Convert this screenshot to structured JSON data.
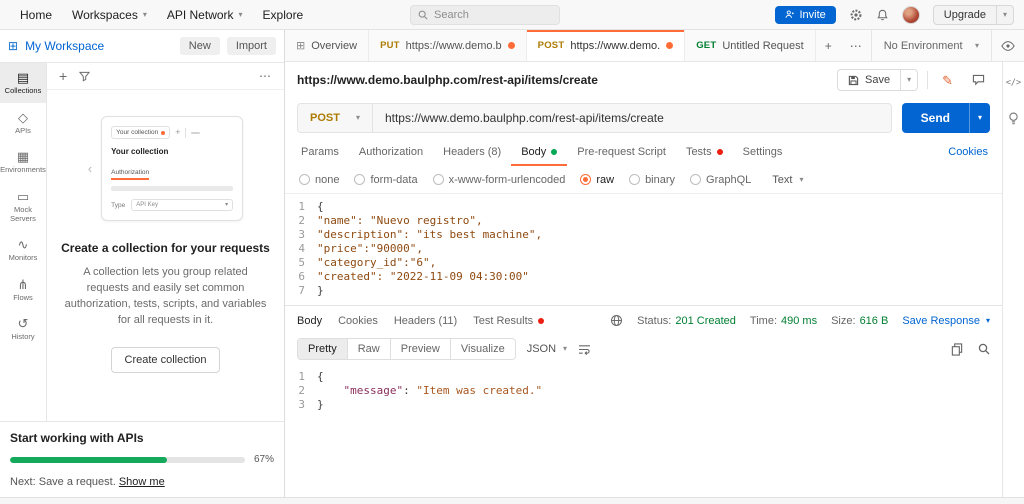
{
  "icons": {
    "caret": "▾",
    "grid": "⊞",
    "plus": "+",
    "ellipsis": "⋯",
    "code": "</>",
    "collapse": "‹",
    "pencil": "✎",
    "workspace": "⊞"
  },
  "topbar": {
    "nav": [
      "Home",
      "Workspaces",
      "API Network",
      "Explore"
    ],
    "search_placeholder": "Search",
    "invite_label": "Invite",
    "upgrade_label": "Upgrade"
  },
  "sidebar": {
    "workspace_title": "My Workspace",
    "new_button": "New",
    "import_button": "Import",
    "rail": [
      {
        "icon": "▤",
        "label": "Collections"
      },
      {
        "icon": "◇",
        "label": "APIs"
      },
      {
        "icon": "▦",
        "label": "Environments"
      },
      {
        "icon": "▭",
        "label": "Mock Servers"
      },
      {
        "icon": "∿",
        "label": "Monitors"
      },
      {
        "icon": "⋔",
        "label": "Flows"
      },
      {
        "icon": "↺",
        "label": "History"
      }
    ],
    "illustration": {
      "tab_label": "Your collection",
      "title": "Your collection",
      "auth_tab": "Authorization",
      "type_label": "Type",
      "type_value": "API Key"
    },
    "empty": {
      "title": "Create a collection for your requests",
      "description": "A collection lets you group related requests and easily set common authorization, tests, scripts, and variables for all requests in it.",
      "button": "Create collection"
    },
    "footer": {
      "title": "Start working with APIs",
      "percent": "67%",
      "progress_style": "width:67%",
      "next_prefix": "Next: Save a request.",
      "link": "Show me"
    }
  },
  "tabs": {
    "items": [
      {
        "label": "Overview"
      },
      {
        "method": "PUT",
        "label": "https://www.demo.b"
      },
      {
        "method": "POST",
        "label": "https://www.demo."
      },
      {
        "method": "GET",
        "label": "Untitled Request"
      }
    ],
    "environment": "No Environment"
  },
  "request": {
    "title": "https://www.demo.baulphp.com/rest-api/items/create",
    "save_label": "Save",
    "method": "POST",
    "url": "https://www.demo.baulphp.com/rest-api/items/create",
    "send_label": "Send",
    "tabs": [
      "Params",
      "Authorization",
      "Headers (8)",
      "Body",
      "Pre-request Script",
      "Tests",
      "Settings"
    ],
    "cookies_link": "Cookies",
    "body_types": [
      "none",
      "form-data",
      "x-www-form-urlencoded",
      "raw",
      "binary",
      "GraphQL"
    ],
    "language": "Text",
    "body_lines": [
      {
        "n": "1",
        "t": "{"
      },
      {
        "n": "2",
        "t": "\"name\": \"Nuevo registro\","
      },
      {
        "n": "3",
        "t": "\"description\": \"its best machine\","
      },
      {
        "n": "4",
        "t": "\"price\":\"90000\","
      },
      {
        "n": "5",
        "t": "\"category_id\":\"6\","
      },
      {
        "n": "6",
        "t": "\"created\": \"2022-11-09 04:30:00\""
      },
      {
        "n": "7",
        "t": "}"
      }
    ]
  },
  "response": {
    "tabs": [
      "Body",
      "Cookies",
      "Headers (11)",
      "Test Results"
    ],
    "meta": [
      {
        "label": "Status:",
        "value": "201 Created"
      },
      {
        "label": "Time:",
        "value": "490 ms"
      },
      {
        "label": "Size:",
        "value": "616 B"
      }
    ],
    "save_response": "Save Response",
    "views": [
      "Pretty",
      "Raw",
      "Preview",
      "Visualize"
    ],
    "language": "JSON",
    "body_lines": [
      {
        "n": "1",
        "t": "{"
      },
      {
        "n": "2",
        "key": "    \"message\"",
        "sep": ": ",
        "val": "\"Item was created.\""
      },
      {
        "n": "3",
        "t": "}"
      }
    ]
  }
}
